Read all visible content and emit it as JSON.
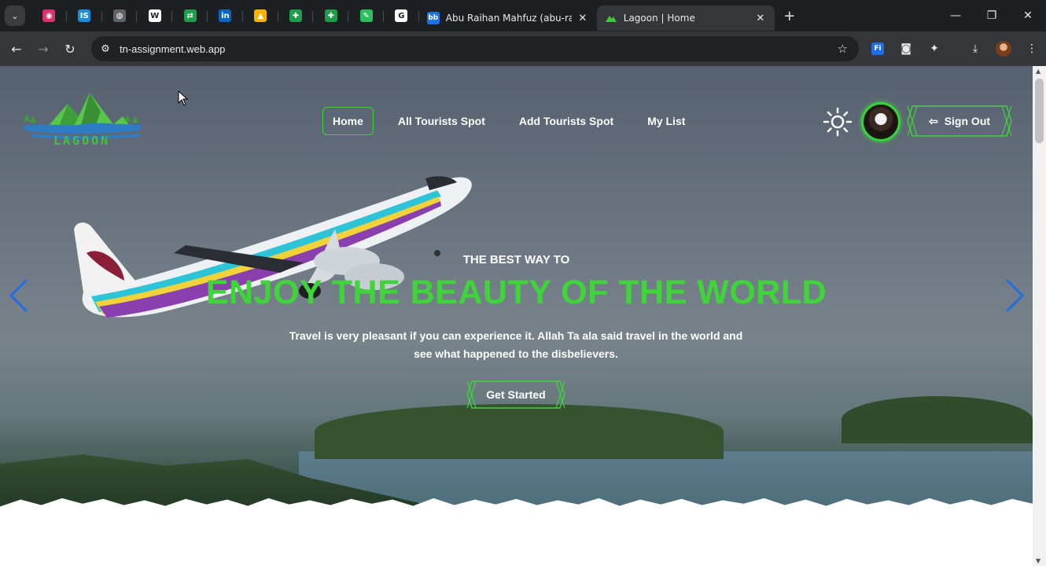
{
  "browser": {
    "pinned_tabs": [
      {
        "icon": "profile-pink-icon",
        "color": "#d6336c",
        "glyph": "◉"
      },
      {
        "icon": "is-icon",
        "color": "#1a8fd8",
        "glyph": "IS"
      },
      {
        "icon": "globe-icon",
        "color": "#5f6368",
        "glyph": "◍"
      },
      {
        "icon": "w-icon",
        "color": "#ffffff",
        "glyph": "W"
      },
      {
        "icon": "sheets-arrow-icon",
        "color": "#1e9e4a",
        "glyph": "⇄"
      },
      {
        "icon": "linkedin-icon",
        "color": "#0a66c2",
        "glyph": "in"
      },
      {
        "icon": "drive-icon",
        "color": "#f4b400",
        "glyph": "▲"
      },
      {
        "icon": "sheets-icon",
        "color": "#1e9e4a",
        "glyph": "✚"
      },
      {
        "icon": "sheets-icon",
        "color": "#1e9e4a",
        "glyph": "✚"
      },
      {
        "icon": "evernote-icon",
        "color": "#2dbe60",
        "glyph": "✎"
      },
      {
        "icon": "google-icon",
        "color": "#ffffff",
        "glyph": "G"
      }
    ],
    "tabs": [
      {
        "title": "Abu Raihan Mahfuz (abu-raihan",
        "favicon": "linkedin-bb-icon",
        "active": false
      },
      {
        "title": "Lagoon | Home",
        "favicon": "lagoon-icon",
        "active": true
      }
    ],
    "url": "tn-assignment.web.app"
  },
  "site": {
    "brand": "LAGOON",
    "nav": [
      "Home",
      "All Tourists Spot",
      "Add Tourists Spot",
      "My List"
    ],
    "active_nav": "Home",
    "sign_out_label": "Sign Out",
    "hero": {
      "eyebrow": "THE BEST WAY TO",
      "headline": "ENJOY THE BEAUTY OF THE WORLD",
      "description": "Travel is very pleasant if you can experience it. Allah Ta ala said travel in the world and see what happened to the disbelievers.",
      "cta_label": "Get Started"
    }
  },
  "colors": {
    "accent": "#3fd53a",
    "chrome_dark": "#1e1f22",
    "toolbar": "#35363a",
    "arrow": "#1e6ee8"
  }
}
